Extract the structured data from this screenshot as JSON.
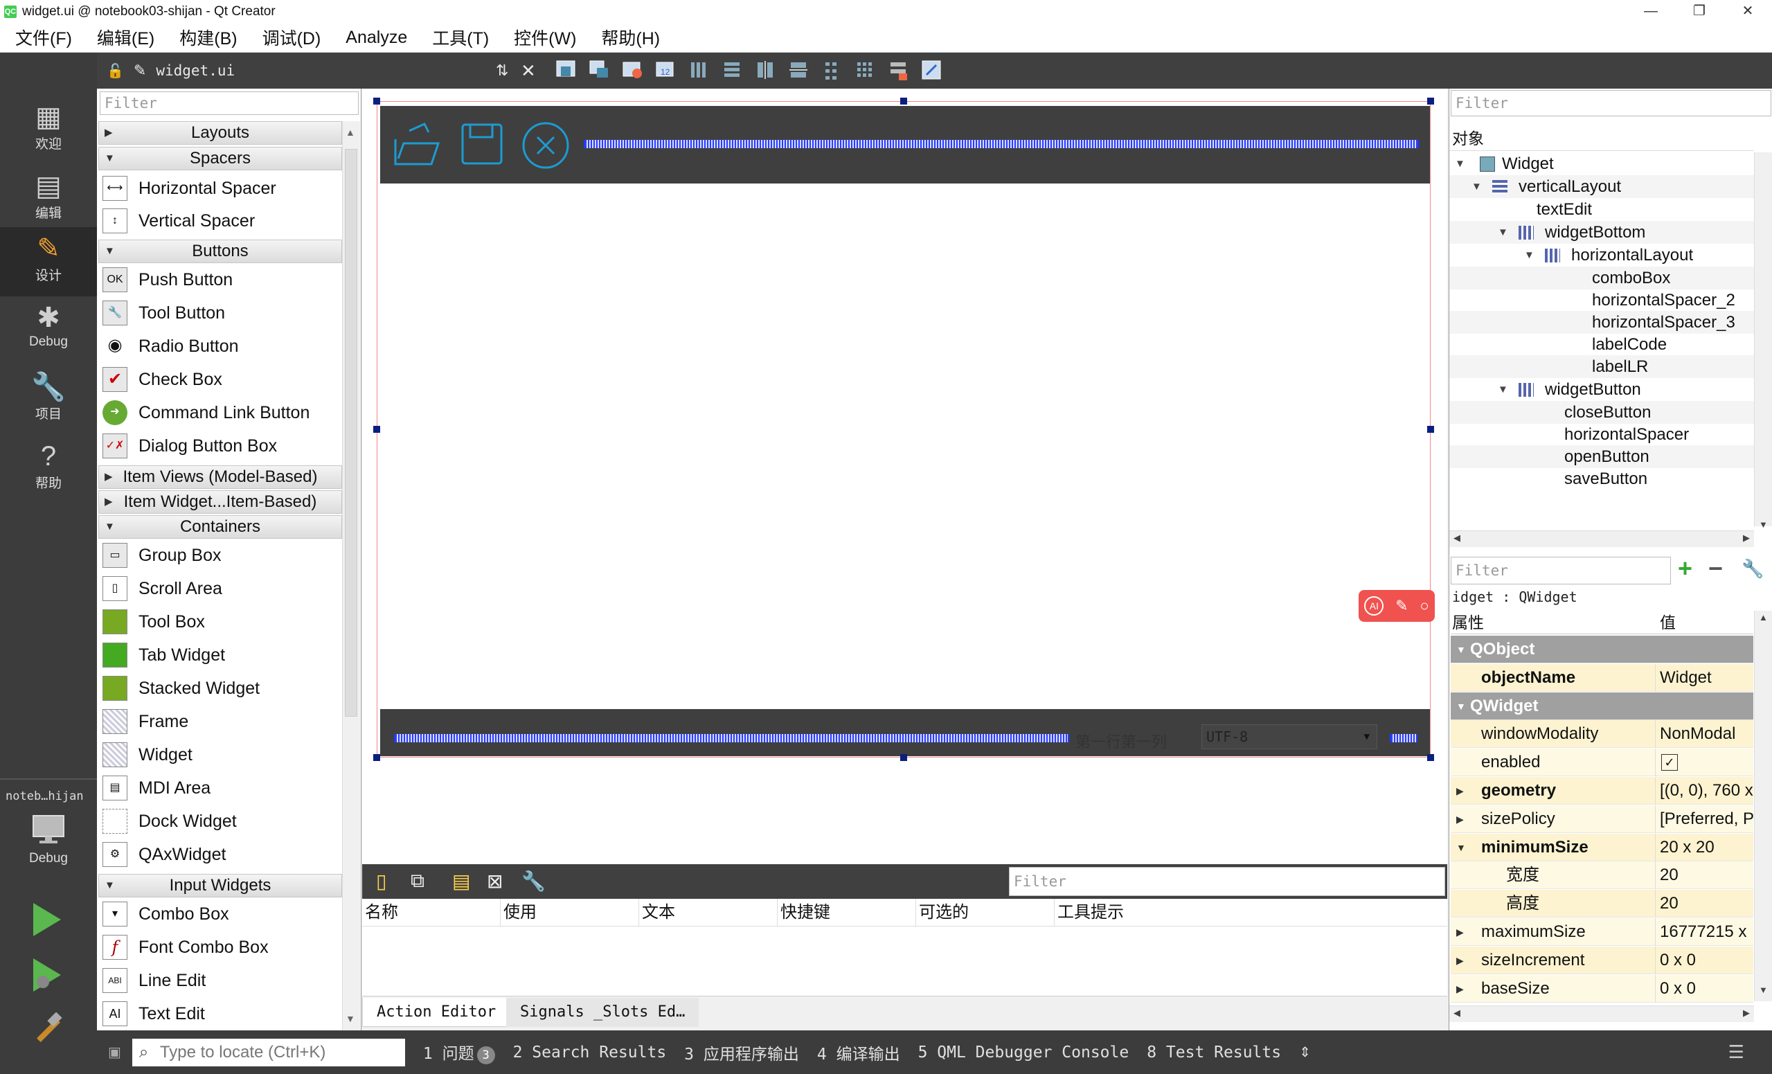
{
  "window": {
    "title": "widget.ui @ notebook03-shijan - Qt Creator",
    "app_icon": "QC",
    "controls": [
      "—",
      "❐",
      "✕"
    ]
  },
  "menu": [
    "文件(F)",
    "编辑(E)",
    "构建(B)",
    "调试(D)",
    "Analyze",
    "工具(T)",
    "控件(W)",
    "帮助(H)"
  ],
  "modes": [
    {
      "icon": "grid-icon",
      "glyph": "▦",
      "label": "欢迎"
    },
    {
      "icon": "edit-icon",
      "glyph": "▤",
      "label": "编辑"
    },
    {
      "icon": "design-icon",
      "glyph": "✎",
      "label": "设计"
    },
    {
      "icon": "bug-icon",
      "glyph": "✱",
      "label": "Debug"
    },
    {
      "icon": "wrench-icon",
      "glyph": "🔧",
      "label": "项目"
    },
    {
      "icon": "help-icon",
      "glyph": "?",
      "label": "帮助"
    }
  ],
  "kit": {
    "project": "noteb…hijan",
    "label": "Debug"
  },
  "editor": {
    "file": "widget.ui",
    "arrows": "⇅",
    "close": "✕"
  },
  "widgetbox": {
    "filter_placeholder": "Filter",
    "categories": {
      "layouts": "Layouts",
      "spacers": "Spacers",
      "buttons": "Buttons",
      "item_views": "Item Views (Model-Based)",
      "item_widgets": "Item Widget...Item-Based)",
      "containers": "Containers",
      "input": "Input Widgets"
    },
    "spacers": [
      "Horizontal Spacer",
      "Vertical Spacer"
    ],
    "buttons": [
      "Push Button",
      "Tool Button",
      "Radio Button",
      "Check Box",
      "Command Link Button",
      "Dialog Button Box"
    ],
    "containers": [
      "Group Box",
      "Scroll Area",
      "Tool Box",
      "Tab Widget",
      "Stacked Widget",
      "Frame",
      "Widget",
      "MDI Area",
      "Dock Widget",
      "QAxWidget"
    ],
    "input": [
      "Combo Box",
      "Font Combo Box",
      "Line Edit",
      "Text Edit"
    ]
  },
  "form": {
    "label_code": "第一行第一列",
    "combo": "UTF-8"
  },
  "action_editor": {
    "filter_placeholder": "Filter",
    "columns": [
      "名称",
      "使用",
      "文本",
      "快捷键",
      "可选的",
      "工具提示"
    ],
    "tabs": [
      "Action Editor",
      "Signals _Slots Ed…"
    ]
  },
  "object_inspector": {
    "filter_placeholder": "Filter",
    "header": "对象",
    "tree": [
      {
        "name": "Widget",
        "depth": 0
      },
      {
        "name": "verticalLayout",
        "depth": 1
      },
      {
        "name": "textEdit",
        "depth": 2
      },
      {
        "name": "widgetBottom",
        "depth": 2
      },
      {
        "name": "horizontalLayout",
        "depth": 3
      },
      {
        "name": "comboBox",
        "depth": 4
      },
      {
        "name": "horizontalSpacer_2",
        "depth": 4
      },
      {
        "name": "horizontalSpacer_3",
        "depth": 4
      },
      {
        "name": "labelCode",
        "depth": 4
      },
      {
        "name": "labelLR",
        "depth": 4
      },
      {
        "name": "widgetButton",
        "depth": 2
      },
      {
        "name": "closeButton",
        "depth": 3
      },
      {
        "name": "horizontalSpacer",
        "depth": 3
      },
      {
        "name": "openButton",
        "depth": 3
      },
      {
        "name": "saveButton",
        "depth": 3
      }
    ]
  },
  "property_editor": {
    "filter_placeholder": "Filter",
    "object": "idget : QWidget",
    "header_prop": "属性",
    "header_val": "值",
    "rows": [
      {
        "k": "QObject",
        "v": "",
        "t": "grp"
      },
      {
        "k": "objectName",
        "v": "Widget",
        "t": "yelb"
      },
      {
        "k": "QWidget",
        "v": "",
        "t": "grp"
      },
      {
        "k": "windowModality",
        "v": "NonModal",
        "t": "y"
      },
      {
        "k": "enabled",
        "v": "✓",
        "t": "y2"
      },
      {
        "k": "geometry",
        "v": "[(0, 0), 760 x",
        "t": "yb"
      },
      {
        "k": "sizePolicy",
        "v": "[Preferred, P",
        "t": "y2"
      },
      {
        "k": "minimumSize",
        "v": "20 x 20",
        "t": "yb"
      },
      {
        "k": "宽度",
        "v": "20",
        "t": "y2s"
      },
      {
        "k": "高度",
        "v": "20",
        "t": "ys"
      },
      {
        "k": "maximumSize",
        "v": "16777215 x",
        "t": "y2"
      },
      {
        "k": "sizeIncrement",
        "v": "0 x 0",
        "t": "y"
      },
      {
        "k": "baseSize",
        "v": "0 x 0",
        "t": "y2"
      }
    ]
  },
  "statusbar": {
    "locate_placeholder": "Type to locate (Ctrl+K)",
    "items": [
      "1  问题",
      "2  Search Results",
      "3  应用程序输出",
      "4  编译输出",
      "5  QML Debugger Console",
      "8  Test Results"
    ],
    "issues_count": "3"
  }
}
